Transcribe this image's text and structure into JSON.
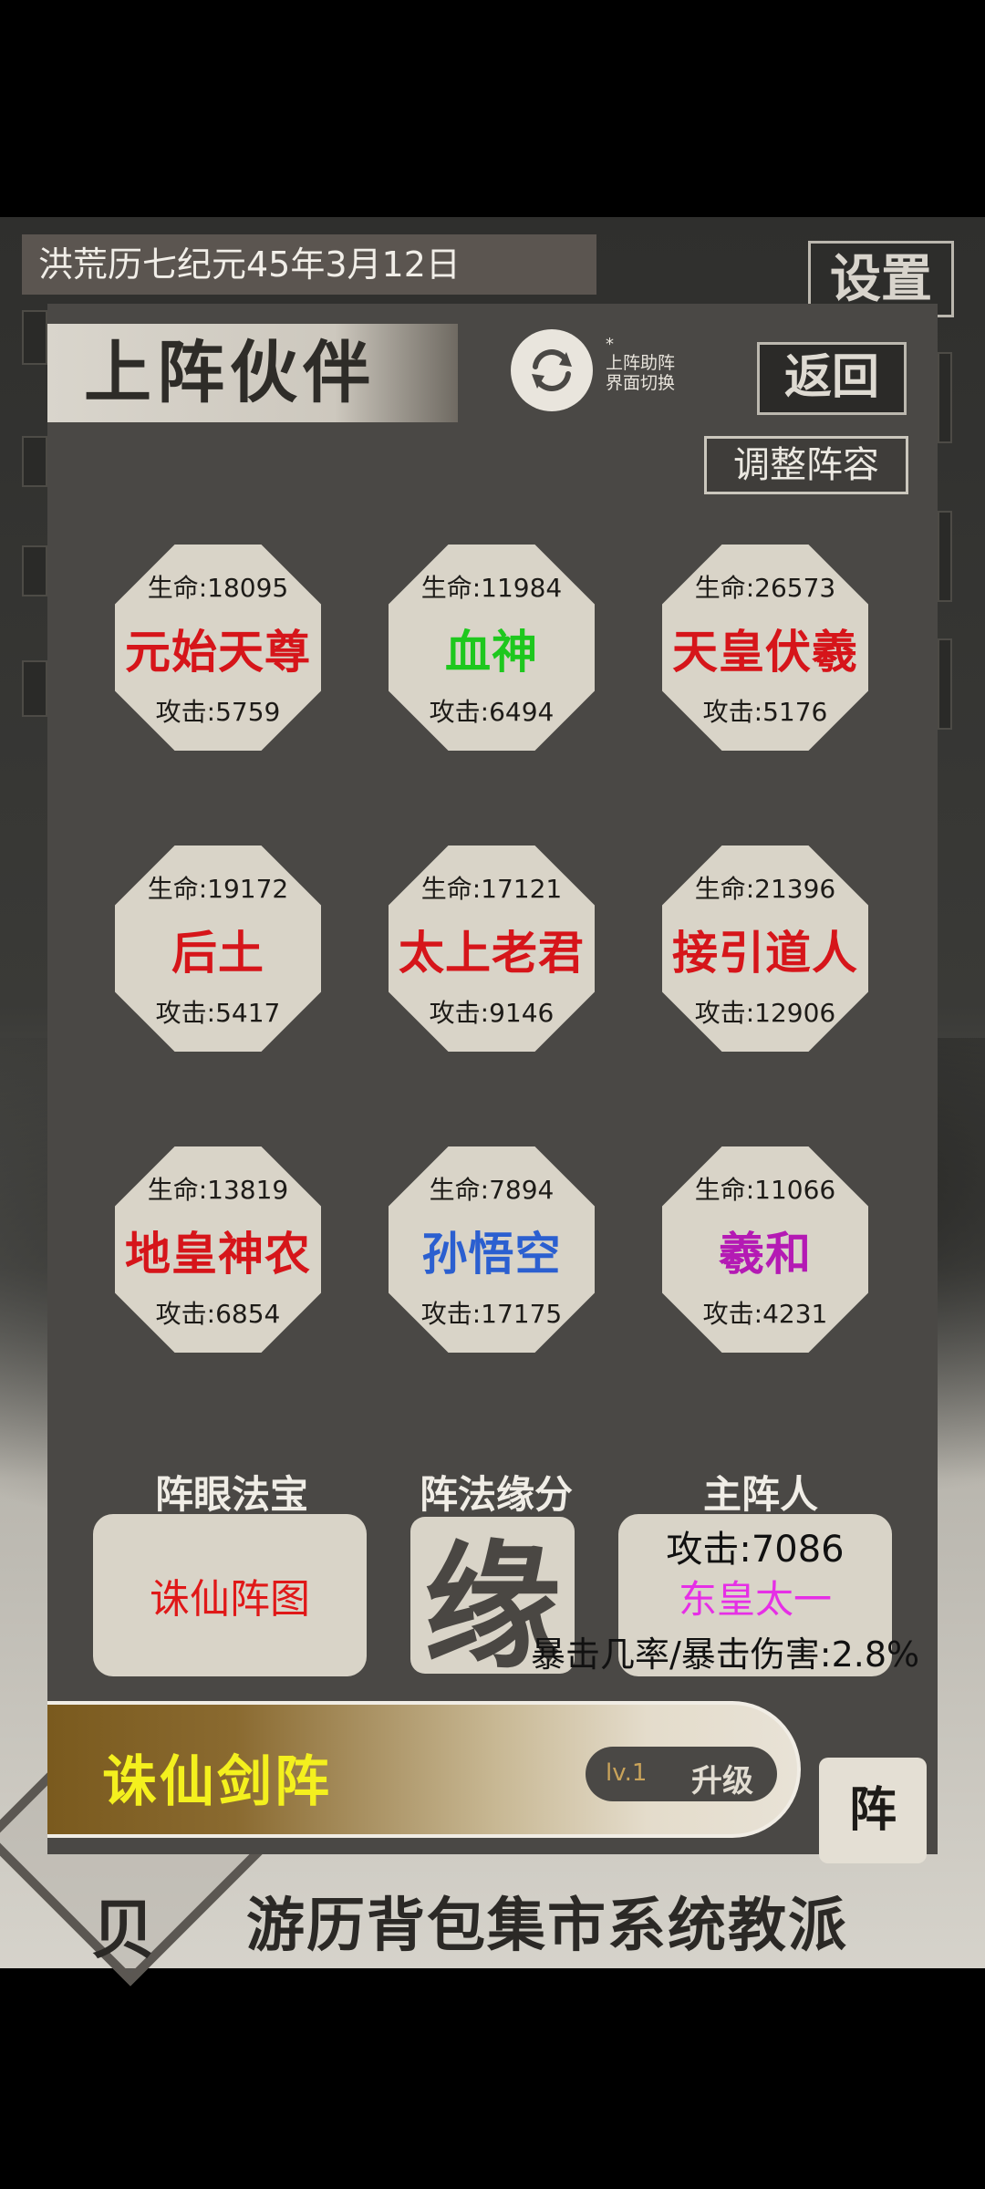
{
  "background": {
    "date_text": "洪荒历七纪元45年3月12日",
    "settings_label": "设置",
    "bottom_nav": [
      "游历",
      "背包",
      "集市",
      "系统",
      "教派"
    ],
    "emblem_glyph": "贝"
  },
  "dialog": {
    "title": "上阵伙伴",
    "switch_note_star": "*",
    "switch_note_line1": "上阵助阵",
    "switch_note_line2": "界面切换",
    "back_label": "返回",
    "adjust_label": "调整阵容"
  },
  "partners": [
    {
      "hp": "生命:18095",
      "name": "元始天尊",
      "atk": "攻击:5759",
      "color": "#d6151a"
    },
    {
      "hp": "生命:11984",
      "name": "血神",
      "atk": "攻击:6494",
      "color": "#1ec81e"
    },
    {
      "hp": "生命:26573",
      "name": "天皇伏羲",
      "atk": "攻击:5176",
      "color": "#d6151a"
    },
    {
      "hp": "生命:19172",
      "name": "后土",
      "atk": "攻击:5417",
      "color": "#d6151a"
    },
    {
      "hp": "生命:17121",
      "name": "太上老君",
      "atk": "攻击:9146",
      "color": "#d6151a"
    },
    {
      "hp": "生命:21396",
      "name": "接引道人",
      "atk": "攻击:12906",
      "color": "#d6151a"
    },
    {
      "hp": "生命:13819",
      "name": "地皇神农",
      "atk": "攻击:6854",
      "color": "#d6151a"
    },
    {
      "hp": "生命:7894",
      "name": "孙悟空",
      "atk": "攻击:17175",
      "color": "#2b5fd0"
    },
    {
      "hp": "生命:11066",
      "name": "羲和",
      "atk": "攻击:4231",
      "color": "#b41ab4"
    }
  ],
  "bottom": {
    "treasure_label": "阵眼法宝",
    "treasure_name": "诛仙阵图",
    "fate_label": "阵法缘分",
    "fate_glyph": "缘",
    "lord_label": "主阵人",
    "lord_attack": "攻击:7086",
    "lord_name": "东皇太一",
    "crit_text": "暴击几率/暴击伤害:2.8%",
    "formation_name": "诛仙剑阵",
    "level": "lv.1",
    "upgrade_label": "升级",
    "formation_button": "阵"
  }
}
